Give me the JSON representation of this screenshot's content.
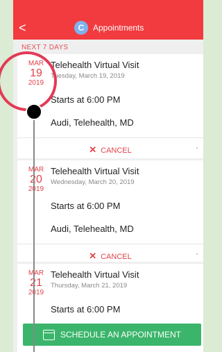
{
  "header": {
    "title": "Appointments",
    "back_label": "<",
    "logo_letter": "C"
  },
  "section_label": "NEXT 7 DAYS",
  "appointments": [
    {
      "month": "MAR",
      "day": "19",
      "year": "2019",
      "title": "Telehealth Virtual Visit",
      "date_line": "Tuesday, March 19, 2019",
      "start": "Starts at 6:00 PM",
      "provider": "Audi, Telehealth, MD",
      "cancel_label": "CANCEL"
    },
    {
      "month": "MAR",
      "day": "20",
      "year": "2019",
      "title": "Telehealth Virtual Visit",
      "date_line": "Wednesday, March 20, 2019",
      "start": "Starts at 6:00 PM",
      "provider": "Audi, Telehealth, MD",
      "cancel_label": "CANCEL"
    },
    {
      "month": "MAR",
      "day": "21",
      "year": "2019",
      "title": "Telehealth Virtual Visit",
      "date_line": "Thursday, March 21, 2019",
      "start": "Starts at 6:00 PM",
      "provider": "",
      "cancel_label": ""
    }
  ],
  "cta": {
    "label": "SCHEDULE AN APPOINTMENT"
  },
  "bottom": {
    "left": "",
    "right": ""
  },
  "colors": {
    "header": "#f23b3f",
    "accent": "#e2434a",
    "cta": "#3bb56b"
  }
}
